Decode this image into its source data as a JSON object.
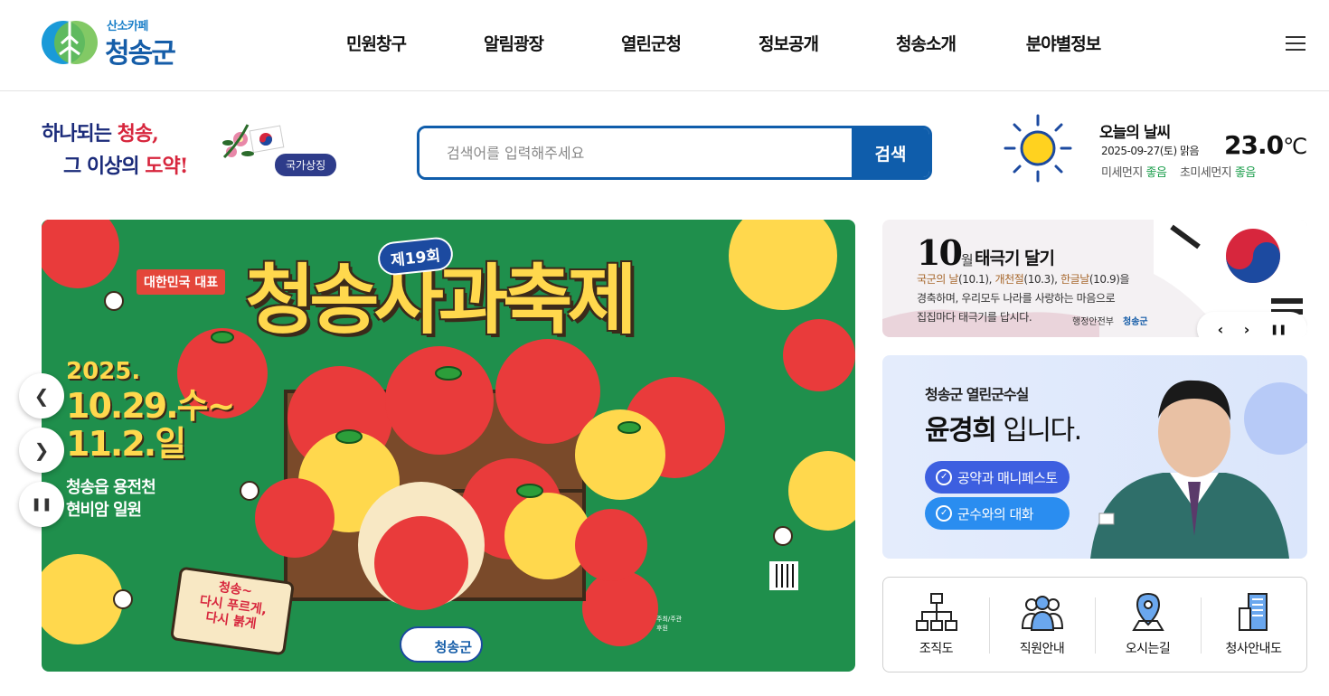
{
  "header": {
    "logo_small": "산소카페",
    "logo_big": "청송군",
    "nav": [
      "민원창구",
      "알림광장",
      "열린군청",
      "정보공개",
      "청송소개",
      "분야별정보"
    ]
  },
  "slogan": {
    "line1_a": "하나되는 ",
    "line1_b": "청송,",
    "line2_a": "그 이상의 ",
    "line2_b": "도약!"
  },
  "national_symbol_label": "국가상징",
  "search": {
    "placeholder": "검색어를 입력해주세요",
    "button": "검색"
  },
  "weather": {
    "title": "오늘의 날씨",
    "date": "2025-09-27(토)",
    "condition": "맑음",
    "temp": "23.0",
    "unit": "℃",
    "dust_label": "미세먼지",
    "dust_value": "좋음",
    "fine_dust_label": "초미세먼지",
    "fine_dust_value": "좋음",
    "icon": "sun-icon"
  },
  "banner": {
    "edition": "제19회",
    "title": "청송사과축제",
    "rep": "대한민국 대표",
    "year": "2025.",
    "date1": "10.29.수~",
    "date2": "11.2.일",
    "place1": "청송읍 용전천",
    "place2": "현비암 일원",
    "sign": "청송~\n다시 푸르게,\n다시 붉게",
    "logo": "청송군",
    "host_label": "주최/주관",
    "sponsor_label": "후원"
  },
  "flag_banner": {
    "month": "10",
    "month_suffix": "월",
    "title": "태극기 달기",
    "hol1": "국군의 날",
    "hol1_date": "(10.1), ",
    "hol2": "개천절",
    "hol2_date": "(10.3), ",
    "hol3": "한글날",
    "hol3_date": "(10.9)을",
    "text2": "경축하며, 우리모두 나라를 사랑하는 마음으로",
    "text3": "집집마다 태극기를 답시다.",
    "org1": "행정안전부",
    "org2": "청송군"
  },
  "mayor": {
    "subtitle": "청송군 열린군수실",
    "name": "윤경희",
    "name_suffix": " 입니다.",
    "btn1": "공약과 매니페스토",
    "btn2": "군수와의 대화"
  },
  "quick_links": [
    {
      "label": "조직도",
      "icon": "org-chart-icon"
    },
    {
      "label": "직원안내",
      "icon": "staff-icon"
    },
    {
      "label": "오시는길",
      "icon": "location-pin-icon"
    },
    {
      "label": "청사안내도",
      "icon": "building-icon"
    }
  ],
  "colors": {
    "primary": "#0f5dab",
    "banner_green": "#1f8f4c",
    "accent_red": "#d7263d",
    "good": "#1b9e4b"
  }
}
